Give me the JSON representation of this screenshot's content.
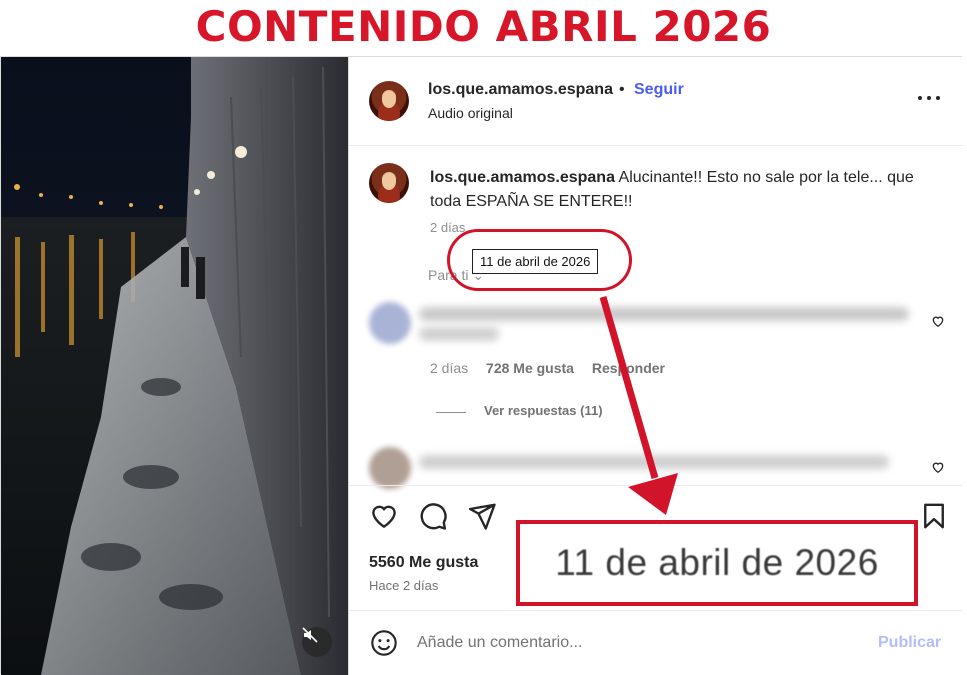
{
  "banner": {
    "title": "CONTENIDO ABRIL 2026"
  },
  "header": {
    "username": "los.que.amamos.espana",
    "separator": "•",
    "follow_label": "Seguir",
    "audio_label": "Audio original"
  },
  "caption": {
    "username": "los.que.amamos.espana",
    "text": "Alucinante!! Esto no sale por la tele... que toda ESPAÑA SE ENTERE!!",
    "time": "2 días",
    "tooltip": "11 de abril de 2026",
    "for_you": "Para ti ⌄"
  },
  "comment": {
    "time": "2 días",
    "likes": "728 Me gusta",
    "reply_label": "Responder",
    "view_replies": "Ver respuestas (11)"
  },
  "actions": {
    "like_icon": "heart-icon",
    "comment_icon": "comment-icon",
    "share_icon": "share-icon",
    "save_icon": "bookmark-icon"
  },
  "stats": {
    "likes": "5560 Me gusta",
    "posted": "Hace 2 días"
  },
  "zoom": {
    "date": "11 de abril de 2026"
  },
  "composer": {
    "placeholder": "Añade un comentario...",
    "publish_label": "Publicar"
  },
  "colors": {
    "banner_red": "#d8162a",
    "callout_red": "#d2142b",
    "link_blue": "#4a5df9",
    "publish_disabled": "#b3bef9"
  }
}
